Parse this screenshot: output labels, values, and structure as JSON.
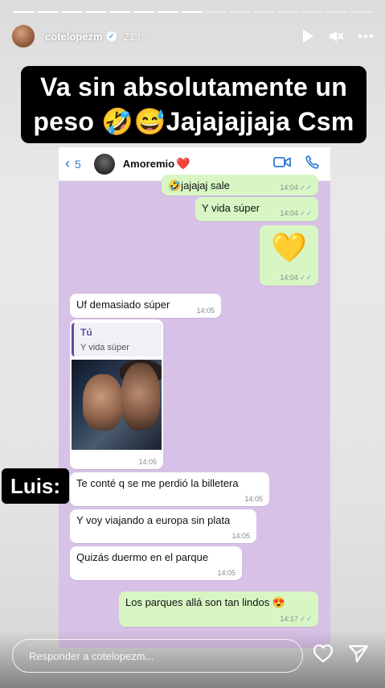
{
  "story": {
    "progress_segments_total": 15,
    "progress_segments_done": 8,
    "username": "cotelopezm",
    "time_ago": "21 h",
    "caption_line1": "Va sin absolutamente un",
    "caption_line2": "peso 🤣😅Jajajajjaja Csm",
    "label_luis": "Luis:",
    "reply_placeholder": "Responder a cotelopezm..."
  },
  "chat": {
    "back_count": "5",
    "contact_name": "Amoremio",
    "contact_emoji": "❤️",
    "messages": [
      {
        "text": "🤣jajajaj sale",
        "time": "14:04",
        "dir": "out"
      },
      {
        "text": "Y vida súper",
        "time": "14:04",
        "dir": "out"
      },
      {
        "text": "💛",
        "time": "14:04",
        "dir": "out"
      },
      {
        "text": "Uf demasiado súper",
        "time": "14:05",
        "dir": "in"
      },
      {
        "reply_author": "Tú",
        "reply_text": "Y vida súper",
        "time": "14:05",
        "dir": "in"
      },
      {
        "text": "Te conté q se me perdió la billetera",
        "time": "14:05",
        "dir": "in"
      },
      {
        "text": "Y voy viajando a europa sin plata",
        "time": "14:05",
        "dir": "in"
      },
      {
        "text": "Quizás duermo en el parque",
        "time": "14:05",
        "dir": "in"
      },
      {
        "text": "Los parques allá son tan lindos 😍",
        "time": "14:17",
        "dir": "out"
      }
    ]
  },
  "icons": {
    "play": "play-icon",
    "mute": "mute-icon",
    "more": "more-icon",
    "video": "video-call-icon",
    "phone": "phone-icon",
    "heart": "heart-icon",
    "send": "send-icon"
  },
  "colors": {
    "chat_bg": "#d8c1e6",
    "out_bubble": "#d7f6c4",
    "in_bubble": "#ffffff",
    "accent_blue": "#2b78d4"
  }
}
